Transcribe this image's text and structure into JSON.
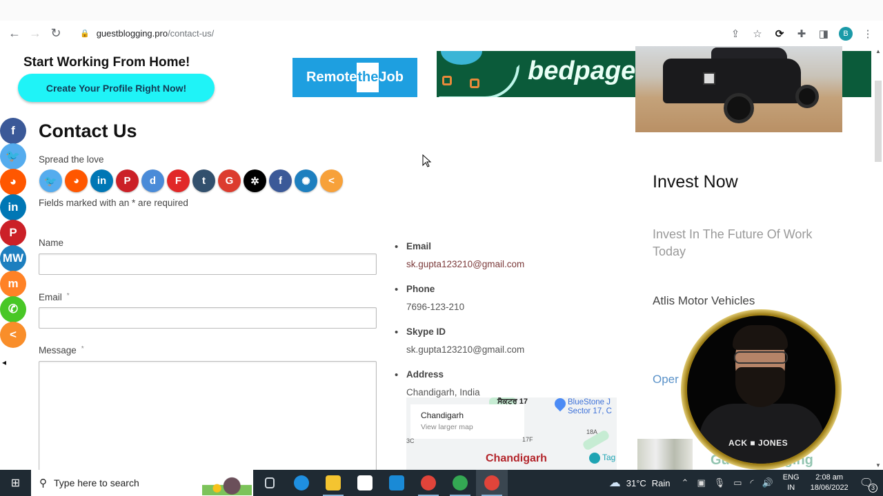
{
  "browser": {
    "url_domain": "guestblogging.pro",
    "url_path": "/contact-us/",
    "profile_initial": "B",
    "icons": [
      "back-icon",
      "forward-icon",
      "reload-icon",
      "lock-icon",
      "share-icon",
      "star-icon",
      "sync-icon",
      "extensions-icon",
      "side-panel-icon",
      "menu-icon"
    ]
  },
  "ads": {
    "work_from_home_title": "Start Working From Home!",
    "work_from_home_button": "Create Your Profile Right Now!",
    "remote_pre": "Remote",
    "remote_mid": "the",
    "remote_post": "Job",
    "bedpage": "bedpage"
  },
  "page": {
    "title": "Contact Us",
    "spread_label": "Spread the love",
    "required_note": "Fields marked with an * are required"
  },
  "floating_share": [
    {
      "name": "facebook",
      "glyph": "f",
      "color": "#3b5998"
    },
    {
      "name": "twitter",
      "glyph": "🐦",
      "color": "#55acee"
    },
    {
      "name": "reddit",
      "glyph": "◕",
      "color": "#ff5700"
    },
    {
      "name": "linkedin",
      "glyph": "in",
      "color": "#0077b5"
    },
    {
      "name": "pinterest",
      "glyph": "P",
      "color": "#cb2027"
    },
    {
      "name": "mewe",
      "glyph": "MW",
      "color": "#1d7fbf"
    },
    {
      "name": "mix",
      "glyph": "m",
      "color": "#ff8226"
    },
    {
      "name": "whatsapp",
      "glyph": "✆",
      "color": "#48c726"
    },
    {
      "name": "more",
      "glyph": "<",
      "color": "#f98e2a"
    }
  ],
  "share_row": [
    {
      "name": "twitter",
      "glyph": "🐦",
      "color": "#55acee"
    },
    {
      "name": "reddit",
      "glyph": "◕",
      "color": "#ff5700"
    },
    {
      "name": "linkedin",
      "glyph": "in",
      "color": "#0077b5"
    },
    {
      "name": "pinterest",
      "glyph": "P",
      "color": "#cb2027"
    },
    {
      "name": "diigo",
      "glyph": "d",
      "color": "#4a8bd8"
    },
    {
      "name": "flipboard",
      "glyph": "F",
      "color": "#e12828"
    },
    {
      "name": "tumblr",
      "glyph": "t",
      "color": "#32506d"
    },
    {
      "name": "google",
      "glyph": "G",
      "color": "#dc3c2e"
    },
    {
      "name": "mix",
      "glyph": "✲",
      "color": "#000000"
    },
    {
      "name": "facebook",
      "glyph": "f",
      "color": "#3b5998"
    },
    {
      "name": "ok",
      "glyph": "✺",
      "color": "#1d7fbf"
    },
    {
      "name": "more",
      "glyph": "<",
      "color": "#f7a13a"
    }
  ],
  "form": {
    "name_label": "Name",
    "email_label": "Email",
    "message_label": "Message",
    "required_mark": "*",
    "name_value": "",
    "email_value": "",
    "message_value": ""
  },
  "contact": [
    {
      "key": "Email",
      "value": "sk.gupta123210@gmail.com",
      "link": true
    },
    {
      "key": "Phone",
      "value": "7696-123-210",
      "link": false
    },
    {
      "key": "Skype ID",
      "value": "sk.gupta123210@gmail.com",
      "link": false
    },
    {
      "key": "Address",
      "value": "Chandigarh, India",
      "link": false
    }
  ],
  "map": {
    "place": "Chandigarh",
    "view_larger": "View larger map",
    "label_punjabi": "ਸੈਕਟਰ 17",
    "label_3c": "3C",
    "label_17f": "17F",
    "label_18a": "18A",
    "poi_line1": "BlueStone J",
    "poi_line2": "Sector 17, C",
    "city_big": "Chandigarh",
    "poi_tag": "Tag"
  },
  "sidebar": {
    "title": "Invest Now",
    "subtitle": "Invest In The Future Of Work Today",
    "atlis": "Atlis Motor Vehicles",
    "open_partial": "Oper",
    "guest_partial": "Guest Blogging"
  },
  "webcam": {
    "shirt_text": "ACK ■ JONES"
  },
  "taskbar": {
    "search_placeholder": "Type here to search",
    "weather_temp": "31°C",
    "weather_desc": "Rain",
    "lang_top": "ENG",
    "lang_bottom": "IN",
    "time": "2:08 am",
    "date": "18/06/2022",
    "notification_count": "3",
    "apps": [
      {
        "name": "task-view",
        "color": "#cfd6dc",
        "active": false
      },
      {
        "name": "edge",
        "color": "#1f8fe0",
        "active": false
      },
      {
        "name": "file-explorer",
        "color": "#f4c430",
        "active": true
      },
      {
        "name": "store",
        "color": "#ffffff",
        "active": false
      },
      {
        "name": "mail",
        "color": "#1a8ad6",
        "active": false
      },
      {
        "name": "chrome-1",
        "color": "#e0443a",
        "active": true
      },
      {
        "name": "chrome-2",
        "color": "#34a853",
        "active": true
      },
      {
        "name": "chrome-3",
        "color": "#e0443a",
        "active": true
      }
    ]
  }
}
